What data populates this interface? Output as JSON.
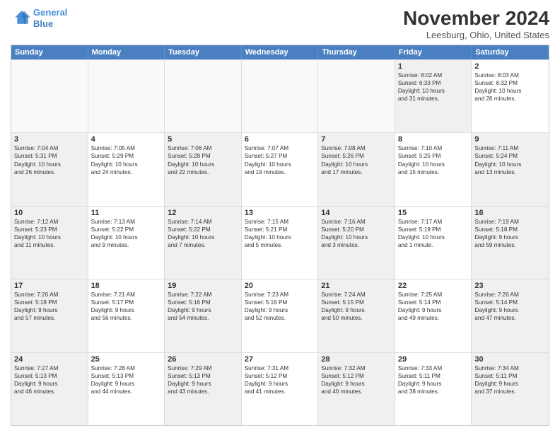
{
  "logo": {
    "line1": "General",
    "line2": "Blue"
  },
  "title": "November 2024",
  "location": "Leesburg, Ohio, United States",
  "days_of_week": [
    "Sunday",
    "Monday",
    "Tuesday",
    "Wednesday",
    "Thursday",
    "Friday",
    "Saturday"
  ],
  "weeks": [
    [
      {
        "day": "",
        "empty": true,
        "lines": []
      },
      {
        "day": "",
        "empty": true,
        "lines": []
      },
      {
        "day": "",
        "empty": true,
        "lines": []
      },
      {
        "day": "",
        "empty": true,
        "lines": []
      },
      {
        "day": "",
        "empty": true,
        "lines": []
      },
      {
        "day": "1",
        "shaded": true,
        "lines": [
          "Sunrise: 8:02 AM",
          "Sunset: 6:33 PM",
          "Daylight: 10 hours",
          "and 31 minutes."
        ]
      },
      {
        "day": "2",
        "lines": [
          "Sunrise: 8:03 AM",
          "Sunset: 6:32 PM",
          "Daylight: 10 hours",
          "and 28 minutes."
        ]
      }
    ],
    [
      {
        "day": "3",
        "shaded": true,
        "lines": [
          "Sunrise: 7:04 AM",
          "Sunset: 5:31 PM",
          "Daylight: 10 hours",
          "and 26 minutes."
        ]
      },
      {
        "day": "4",
        "lines": [
          "Sunrise: 7:05 AM",
          "Sunset: 5:29 PM",
          "Daylight: 10 hours",
          "and 24 minutes."
        ]
      },
      {
        "day": "5",
        "shaded": true,
        "lines": [
          "Sunrise: 7:06 AM",
          "Sunset: 5:28 PM",
          "Daylight: 10 hours",
          "and 22 minutes."
        ]
      },
      {
        "day": "6",
        "lines": [
          "Sunrise: 7:07 AM",
          "Sunset: 5:27 PM",
          "Daylight: 10 hours",
          "and 19 minutes."
        ]
      },
      {
        "day": "7",
        "shaded": true,
        "lines": [
          "Sunrise: 7:08 AM",
          "Sunset: 5:26 PM",
          "Daylight: 10 hours",
          "and 17 minutes."
        ]
      },
      {
        "day": "8",
        "lines": [
          "Sunrise: 7:10 AM",
          "Sunset: 5:25 PM",
          "Daylight: 10 hours",
          "and 15 minutes."
        ]
      },
      {
        "day": "9",
        "shaded": true,
        "lines": [
          "Sunrise: 7:11 AM",
          "Sunset: 5:24 PM",
          "Daylight: 10 hours",
          "and 13 minutes."
        ]
      }
    ],
    [
      {
        "day": "10",
        "shaded": true,
        "lines": [
          "Sunrise: 7:12 AM",
          "Sunset: 5:23 PM",
          "Daylight: 10 hours",
          "and 11 minutes."
        ]
      },
      {
        "day": "11",
        "lines": [
          "Sunrise: 7:13 AM",
          "Sunset: 5:22 PM",
          "Daylight: 10 hours",
          "and 9 minutes."
        ]
      },
      {
        "day": "12",
        "shaded": true,
        "lines": [
          "Sunrise: 7:14 AM",
          "Sunset: 5:22 PM",
          "Daylight: 10 hours",
          "and 7 minutes."
        ]
      },
      {
        "day": "13",
        "lines": [
          "Sunrise: 7:15 AM",
          "Sunset: 5:21 PM",
          "Daylight: 10 hours",
          "and 5 minutes."
        ]
      },
      {
        "day": "14",
        "shaded": true,
        "lines": [
          "Sunrise: 7:16 AM",
          "Sunset: 5:20 PM",
          "Daylight: 10 hours",
          "and 3 minutes."
        ]
      },
      {
        "day": "15",
        "lines": [
          "Sunrise: 7:17 AM",
          "Sunset: 5:19 PM",
          "Daylight: 10 hours",
          "and 1 minute."
        ]
      },
      {
        "day": "16",
        "shaded": true,
        "lines": [
          "Sunrise: 7:19 AM",
          "Sunset: 5:18 PM",
          "Daylight: 9 hours",
          "and 59 minutes."
        ]
      }
    ],
    [
      {
        "day": "17",
        "shaded": true,
        "lines": [
          "Sunrise: 7:20 AM",
          "Sunset: 5:18 PM",
          "Daylight: 9 hours",
          "and 57 minutes."
        ]
      },
      {
        "day": "18",
        "lines": [
          "Sunrise: 7:21 AM",
          "Sunset: 5:17 PM",
          "Daylight: 9 hours",
          "and 56 minutes."
        ]
      },
      {
        "day": "19",
        "shaded": true,
        "lines": [
          "Sunrise: 7:22 AM",
          "Sunset: 5:16 PM",
          "Daylight: 9 hours",
          "and 54 minutes."
        ]
      },
      {
        "day": "20",
        "lines": [
          "Sunrise: 7:23 AM",
          "Sunset: 5:16 PM",
          "Daylight: 9 hours",
          "and 52 minutes."
        ]
      },
      {
        "day": "21",
        "shaded": true,
        "lines": [
          "Sunrise: 7:24 AM",
          "Sunset: 5:15 PM",
          "Daylight: 9 hours",
          "and 50 minutes."
        ]
      },
      {
        "day": "22",
        "lines": [
          "Sunrise: 7:25 AM",
          "Sunset: 5:14 PM",
          "Daylight: 9 hours",
          "and 49 minutes."
        ]
      },
      {
        "day": "23",
        "shaded": true,
        "lines": [
          "Sunrise: 7:26 AM",
          "Sunset: 5:14 PM",
          "Daylight: 9 hours",
          "and 47 minutes."
        ]
      }
    ],
    [
      {
        "day": "24",
        "shaded": true,
        "lines": [
          "Sunrise: 7:27 AM",
          "Sunset: 5:13 PM",
          "Daylight: 9 hours",
          "and 46 minutes."
        ]
      },
      {
        "day": "25",
        "lines": [
          "Sunrise: 7:28 AM",
          "Sunset: 5:13 PM",
          "Daylight: 9 hours",
          "and 44 minutes."
        ]
      },
      {
        "day": "26",
        "shaded": true,
        "lines": [
          "Sunrise: 7:29 AM",
          "Sunset: 5:13 PM",
          "Daylight: 9 hours",
          "and 43 minutes."
        ]
      },
      {
        "day": "27",
        "lines": [
          "Sunrise: 7:31 AM",
          "Sunset: 5:12 PM",
          "Daylight: 9 hours",
          "and 41 minutes."
        ]
      },
      {
        "day": "28",
        "shaded": true,
        "lines": [
          "Sunrise: 7:32 AM",
          "Sunset: 5:12 PM",
          "Daylight: 9 hours",
          "and 40 minutes."
        ]
      },
      {
        "day": "29",
        "lines": [
          "Sunrise: 7:33 AM",
          "Sunset: 5:11 PM",
          "Daylight: 9 hours",
          "and 38 minutes."
        ]
      },
      {
        "day": "30",
        "shaded": true,
        "lines": [
          "Sunrise: 7:34 AM",
          "Sunset: 5:11 PM",
          "Daylight: 9 hours",
          "and 37 minutes."
        ]
      }
    ]
  ]
}
